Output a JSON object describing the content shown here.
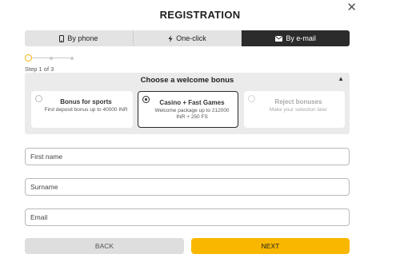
{
  "header": {
    "title": "REGISTRATION",
    "close_icon": "close-icon"
  },
  "tabs": [
    {
      "label": "By phone",
      "icon": "phone-icon",
      "active": false
    },
    {
      "label": "One-click",
      "icon": "lightning-icon",
      "active": false
    },
    {
      "label": "By e-mail",
      "icon": "envelope-icon",
      "active": true
    }
  ],
  "stepper": {
    "text": "Step 1 of 3",
    "current_step": 1,
    "total_steps": 3
  },
  "bonus": {
    "heading": "Choose a welcome bonus",
    "toggle_icon": "chevron-up-icon",
    "options": [
      {
        "title": "Bonus for sports",
        "description": "First deposit bonus up to 40000 INR",
        "selected": false,
        "disabled": false
      },
      {
        "title": "Casino + Fast Games",
        "description": "Welcome package up to 212000 INR + 250 FS",
        "selected": true,
        "disabled": false
      },
      {
        "title": "Reject bonuses",
        "description": "Make your selection later",
        "selected": false,
        "disabled": true
      }
    ]
  },
  "form": {
    "first_name_placeholder": "First name",
    "surname_placeholder": "Surname",
    "email_placeholder": "Email"
  },
  "actions": {
    "back_label": "BACK",
    "next_label": "NEXT"
  },
  "colors": {
    "accent": "#f9b700",
    "active_tab": "#2b2b2b",
    "panel_bg": "#ebebeb"
  }
}
